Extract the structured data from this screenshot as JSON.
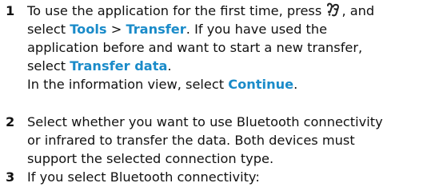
{
  "steps": [
    {
      "number": "1",
      "text": {
        "l1_pre": "To use the application for the first time, press ",
        "l1_icon": "menu-key-icon",
        "l1_post": ", and",
        "l2_pre": "select ",
        "l2_ui_tools": "Tools",
        "l2_sep": " > ",
        "l2_ui_transfer": "Transfer",
        "l2_post": ". If you have used the",
        "l3": "application before and want to start a new transfer,",
        "l4_pre": "select ",
        "l4_ui_transfer_data": "Transfer data",
        "l4_post": ".",
        "l5_pre": "In the information view, select ",
        "l5_ui_continue": "Continue",
        "l5_post": "."
      }
    },
    {
      "number": "2",
      "text": {
        "l1": "Select whether you want to use Bluetooth connectivity",
        "l2": "or infrared to transfer the data. Both devices must",
        "l3": "support the selected connection type."
      }
    },
    {
      "number": "3",
      "text": {
        "l1": "If you select Bluetooth connectivity:"
      }
    }
  ],
  "colors": {
    "ui_text": "#1a8bc9",
    "body_text": "#111111"
  }
}
